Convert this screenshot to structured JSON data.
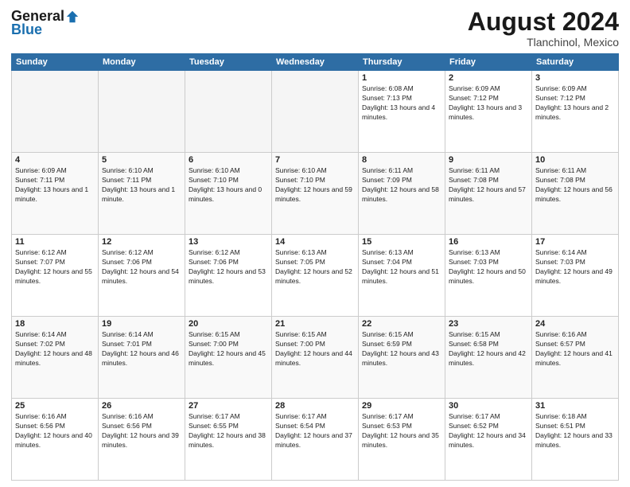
{
  "header": {
    "logo_general": "General",
    "logo_blue": "Blue",
    "month_title": "August 2024",
    "location": "Tlanchinol, Mexico"
  },
  "days_of_week": [
    "Sunday",
    "Monday",
    "Tuesday",
    "Wednesday",
    "Thursday",
    "Friday",
    "Saturday"
  ],
  "weeks": [
    [
      {
        "day": "",
        "info": ""
      },
      {
        "day": "",
        "info": ""
      },
      {
        "day": "",
        "info": ""
      },
      {
        "day": "",
        "info": ""
      },
      {
        "day": "1",
        "sunrise": "Sunrise: 6:08 AM",
        "sunset": "Sunset: 7:13 PM",
        "daylight": "Daylight: 13 hours and 4 minutes."
      },
      {
        "day": "2",
        "sunrise": "Sunrise: 6:09 AM",
        "sunset": "Sunset: 7:12 PM",
        "daylight": "Daylight: 13 hours and 3 minutes."
      },
      {
        "day": "3",
        "sunrise": "Sunrise: 6:09 AM",
        "sunset": "Sunset: 7:12 PM",
        "daylight": "Daylight: 13 hours and 2 minutes."
      }
    ],
    [
      {
        "day": "4",
        "sunrise": "Sunrise: 6:09 AM",
        "sunset": "Sunset: 7:11 PM",
        "daylight": "Daylight: 13 hours and 1 minute."
      },
      {
        "day": "5",
        "sunrise": "Sunrise: 6:10 AM",
        "sunset": "Sunset: 7:11 PM",
        "daylight": "Daylight: 13 hours and 1 minute."
      },
      {
        "day": "6",
        "sunrise": "Sunrise: 6:10 AM",
        "sunset": "Sunset: 7:10 PM",
        "daylight": "Daylight: 13 hours and 0 minutes."
      },
      {
        "day": "7",
        "sunrise": "Sunrise: 6:10 AM",
        "sunset": "Sunset: 7:10 PM",
        "daylight": "Daylight: 12 hours and 59 minutes."
      },
      {
        "day": "8",
        "sunrise": "Sunrise: 6:11 AM",
        "sunset": "Sunset: 7:09 PM",
        "daylight": "Daylight: 12 hours and 58 minutes."
      },
      {
        "day": "9",
        "sunrise": "Sunrise: 6:11 AM",
        "sunset": "Sunset: 7:08 PM",
        "daylight": "Daylight: 12 hours and 57 minutes."
      },
      {
        "day": "10",
        "sunrise": "Sunrise: 6:11 AM",
        "sunset": "Sunset: 7:08 PM",
        "daylight": "Daylight: 12 hours and 56 minutes."
      }
    ],
    [
      {
        "day": "11",
        "sunrise": "Sunrise: 6:12 AM",
        "sunset": "Sunset: 7:07 PM",
        "daylight": "Daylight: 12 hours and 55 minutes."
      },
      {
        "day": "12",
        "sunrise": "Sunrise: 6:12 AM",
        "sunset": "Sunset: 7:06 PM",
        "daylight": "Daylight: 12 hours and 54 minutes."
      },
      {
        "day": "13",
        "sunrise": "Sunrise: 6:12 AM",
        "sunset": "Sunset: 7:06 PM",
        "daylight": "Daylight: 12 hours and 53 minutes."
      },
      {
        "day": "14",
        "sunrise": "Sunrise: 6:13 AM",
        "sunset": "Sunset: 7:05 PM",
        "daylight": "Daylight: 12 hours and 52 minutes."
      },
      {
        "day": "15",
        "sunrise": "Sunrise: 6:13 AM",
        "sunset": "Sunset: 7:04 PM",
        "daylight": "Daylight: 12 hours and 51 minutes."
      },
      {
        "day": "16",
        "sunrise": "Sunrise: 6:13 AM",
        "sunset": "Sunset: 7:03 PM",
        "daylight": "Daylight: 12 hours and 50 minutes."
      },
      {
        "day": "17",
        "sunrise": "Sunrise: 6:14 AM",
        "sunset": "Sunset: 7:03 PM",
        "daylight": "Daylight: 12 hours and 49 minutes."
      }
    ],
    [
      {
        "day": "18",
        "sunrise": "Sunrise: 6:14 AM",
        "sunset": "Sunset: 7:02 PM",
        "daylight": "Daylight: 12 hours and 48 minutes."
      },
      {
        "day": "19",
        "sunrise": "Sunrise: 6:14 AM",
        "sunset": "Sunset: 7:01 PM",
        "daylight": "Daylight: 12 hours and 46 minutes."
      },
      {
        "day": "20",
        "sunrise": "Sunrise: 6:15 AM",
        "sunset": "Sunset: 7:00 PM",
        "daylight": "Daylight: 12 hours and 45 minutes."
      },
      {
        "day": "21",
        "sunrise": "Sunrise: 6:15 AM",
        "sunset": "Sunset: 7:00 PM",
        "daylight": "Daylight: 12 hours and 44 minutes."
      },
      {
        "day": "22",
        "sunrise": "Sunrise: 6:15 AM",
        "sunset": "Sunset: 6:59 PM",
        "daylight": "Daylight: 12 hours and 43 minutes."
      },
      {
        "day": "23",
        "sunrise": "Sunrise: 6:15 AM",
        "sunset": "Sunset: 6:58 PM",
        "daylight": "Daylight: 12 hours and 42 minutes."
      },
      {
        "day": "24",
        "sunrise": "Sunrise: 6:16 AM",
        "sunset": "Sunset: 6:57 PM",
        "daylight": "Daylight: 12 hours and 41 minutes."
      }
    ],
    [
      {
        "day": "25",
        "sunrise": "Sunrise: 6:16 AM",
        "sunset": "Sunset: 6:56 PM",
        "daylight": "Daylight: 12 hours and 40 minutes."
      },
      {
        "day": "26",
        "sunrise": "Sunrise: 6:16 AM",
        "sunset": "Sunset: 6:56 PM",
        "daylight": "Daylight: 12 hours and 39 minutes."
      },
      {
        "day": "27",
        "sunrise": "Sunrise: 6:17 AM",
        "sunset": "Sunset: 6:55 PM",
        "daylight": "Daylight: 12 hours and 38 minutes."
      },
      {
        "day": "28",
        "sunrise": "Sunrise: 6:17 AM",
        "sunset": "Sunset: 6:54 PM",
        "daylight": "Daylight: 12 hours and 37 minutes."
      },
      {
        "day": "29",
        "sunrise": "Sunrise: 6:17 AM",
        "sunset": "Sunset: 6:53 PM",
        "daylight": "Daylight: 12 hours and 35 minutes."
      },
      {
        "day": "30",
        "sunrise": "Sunrise: 6:17 AM",
        "sunset": "Sunset: 6:52 PM",
        "daylight": "Daylight: 12 hours and 34 minutes."
      },
      {
        "day": "31",
        "sunrise": "Sunrise: 6:18 AM",
        "sunset": "Sunset: 6:51 PM",
        "daylight": "Daylight: 12 hours and 33 minutes."
      }
    ]
  ]
}
